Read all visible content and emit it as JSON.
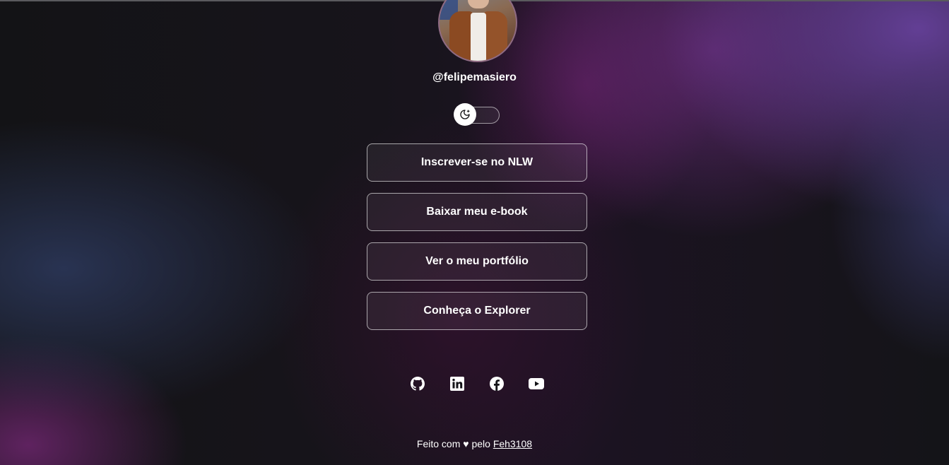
{
  "profile": {
    "username": "@felipemasiero",
    "avatar_alt": ""
  },
  "theme_toggle": {
    "icon": "moon-icon",
    "state": "dark"
  },
  "links": [
    {
      "label": "Inscrever-se no NLW"
    },
    {
      "label": "Baixar meu e-book"
    },
    {
      "label": "Ver o meu portfólio"
    },
    {
      "label": "Conheça o Explorer"
    }
  ],
  "socials": [
    {
      "icon": "github-icon"
    },
    {
      "icon": "linkedin-icon"
    },
    {
      "icon": "facebook-icon"
    },
    {
      "icon": "youtube-icon"
    }
  ],
  "footer": {
    "made_with": "Feito com ♥ pelo",
    "author": "Feh3108"
  },
  "colors": {
    "accent_purple": "#6a3aa0",
    "text": "#ffffff",
    "background": "#121214"
  }
}
